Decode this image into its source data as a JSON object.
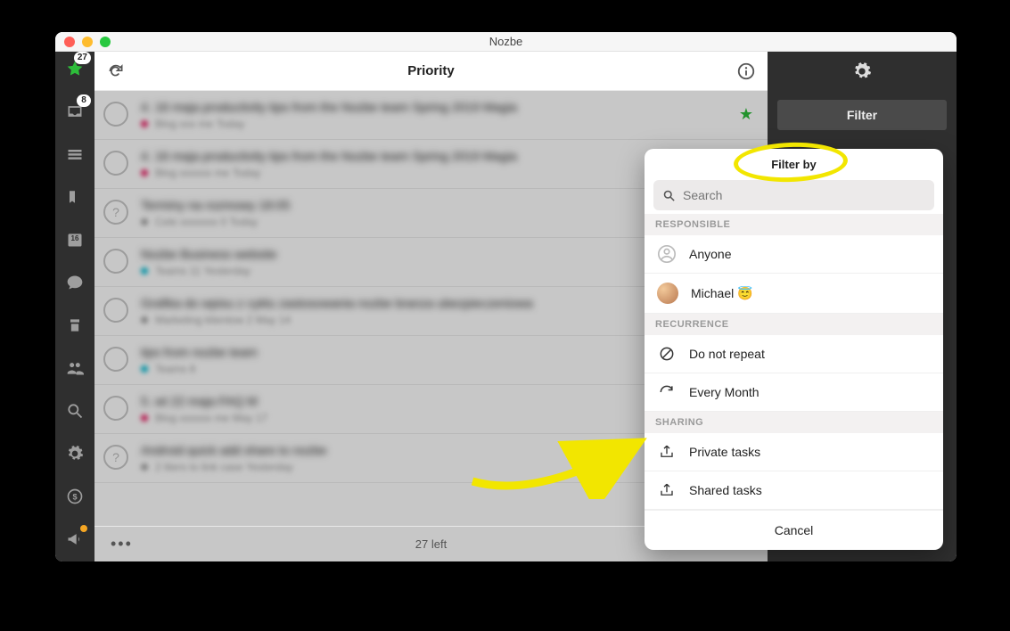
{
  "window_title": "Nozbe",
  "header": {
    "title": "Priority"
  },
  "sidebar": {
    "priority_badge": "27",
    "inbox_badge": "8",
    "calendar_day": "16"
  },
  "rightcol": {
    "filter_label": "Filter"
  },
  "footer": {
    "count_text": "27 left"
  },
  "tasks": [
    {
      "num": "4.",
      "title": "16 maja productivity tips from the Nozbe team Spring 2019 Magia",
      "dot": "pink",
      "meta": "Blog xxx me Today",
      "star": true,
      "q": false
    },
    {
      "num": "4.",
      "title": "16 maja productivity tips from the Nozbe team Spring 2019 Magia",
      "dot": "pink",
      "meta": "Blog xxxxxx me Today",
      "star": false,
      "q": false
    },
    {
      "num": "",
      "title": "Terminy na rozmowy 18:05",
      "dot": "grey",
      "meta": "Cele xxxxxxx 0 Today",
      "star": false,
      "q": true
    },
    {
      "num": "",
      "title": "Nozbe Business website",
      "dot": "cyan",
      "meta": "Teams 11 Yesterday",
      "star": false,
      "q": false
    },
    {
      "num": "",
      "title": "Grafika do wpisu z cyklu zastosowania nozbe branza ubezpieczeniowa",
      "dot": "grey",
      "meta": "Marketing klientow 2 May 14",
      "star": false,
      "q": false
    },
    {
      "num": "",
      "title": "tips from nozbe team",
      "dot": "cyan",
      "meta": "Teams 8",
      "star": false,
      "q": false
    },
    {
      "num": "5.",
      "title": "wt 22 maja FAQ M",
      "dot": "pink",
      "meta": "Blog xxxxxx me May 17",
      "star": false,
      "q": false
    },
    {
      "num": "",
      "title": "Android quick add share to nozbe",
      "dot": "grey",
      "meta": "2 liters to link case Yesterday",
      "star": false,
      "q": true
    }
  ],
  "popup": {
    "title": "Filter by",
    "search_placeholder": "Search",
    "section_responsible": "RESPONSIBLE",
    "responsible_anyone": "Anyone",
    "responsible_user": "Michael",
    "responsible_user_emoji": "😇",
    "section_recurrence": "RECURRENCE",
    "recur_none": "Do not repeat",
    "recur_month": "Every Month",
    "section_sharing": "SHARING",
    "sharing_private": "Private tasks",
    "sharing_shared": "Shared tasks",
    "cancel": "Cancel"
  }
}
